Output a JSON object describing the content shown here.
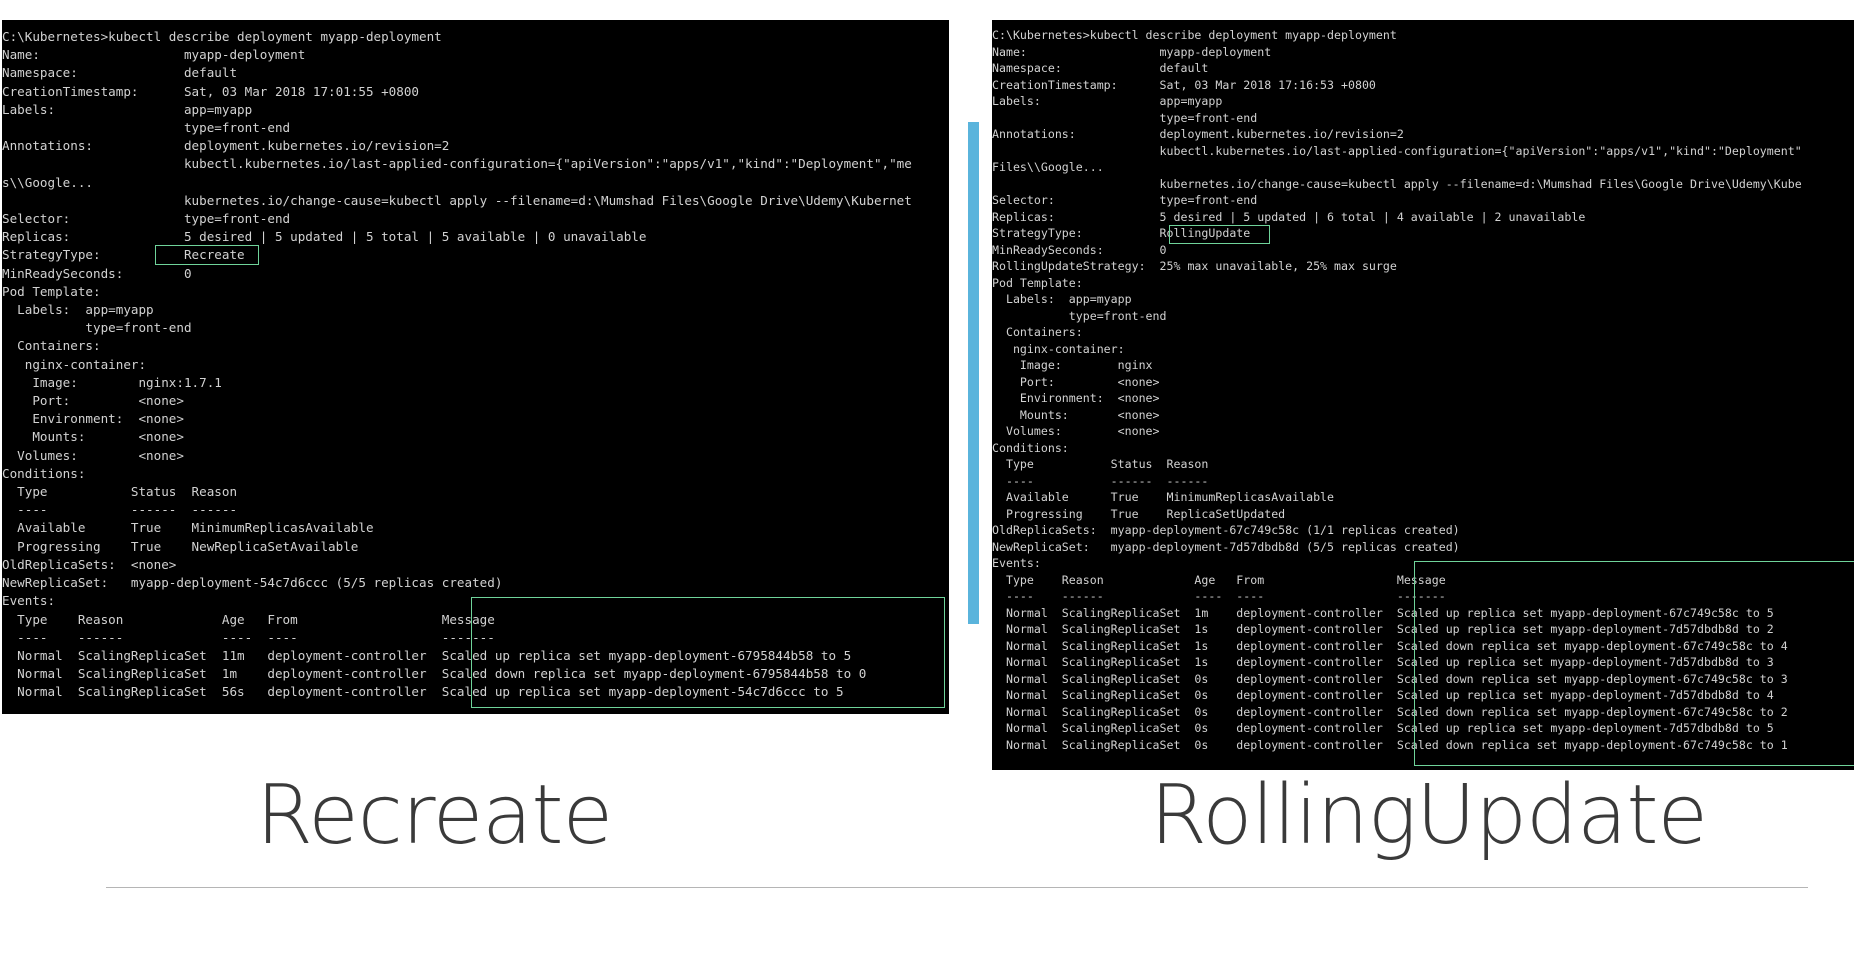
{
  "colors": {
    "terminal_bg": "#000000",
    "terminal_text": "#d2d2d2",
    "highlight_box": "#6fd39a",
    "accent_bar": "#5ab4dc",
    "caption_text": "#3a3a3a",
    "divider": "#b5b5b5"
  },
  "left_terminal": {
    "lines": [
      "C:\\Kubernetes>kubectl describe deployment myapp-deployment",
      "Name:                   myapp-deployment",
      "Namespace:              default",
      "CreationTimestamp:      Sat, 03 Mar 2018 17:01:55 +0800",
      "Labels:                 app=myapp",
      "                        type=front-end",
      "Annotations:            deployment.kubernetes.io/revision=2",
      "                        kubectl.kubernetes.io/last-applied-configuration={\"apiVersion\":\"apps/v1\",\"kind\":\"Deployment\",\"me",
      "s\\\\Google...",
      "                        kubernetes.io/change-cause=kubectl apply --filename=d:\\Mumshad Files\\Google Drive\\Udemy\\Kubernet",
      "Selector:               type=front-end",
      "Replicas:               5 desired | 5 updated | 5 total | 5 available | 0 unavailable",
      "StrategyType:           Recreate",
      "MinReadySeconds:        0",
      "Pod Template:",
      "  Labels:  app=myapp",
      "           type=front-end",
      "  Containers:",
      "   nginx-container:",
      "    Image:        nginx:1.7.1",
      "    Port:         <none>",
      "    Environment:  <none>",
      "    Mounts:       <none>",
      "  Volumes:        <none>",
      "Conditions:",
      "  Type           Status  Reason",
      "  ----           ------  ------",
      "  Available      True    MinimumReplicasAvailable",
      "  Progressing    True    NewReplicaSetAvailable",
      "OldReplicaSets:  <none>",
      "NewReplicaSet:   myapp-deployment-54c7d6ccc (5/5 replicas created)",
      "Events:",
      "  Type    Reason             Age   From                   Message",
      "  ----    ------             ----  ----                   -------",
      "  Normal  ScalingReplicaSet  11m   deployment-controller  Scaled up replica set myapp-deployment-6795844b58 to 5",
      "  Normal  ScalingReplicaSet  1m    deployment-controller  Scaled down replica set myapp-deployment-6795844b58 to 0",
      "  Normal  ScalingReplicaSet  56s   deployment-controller  Scaled up replica set myapp-deployment-54c7d6ccc to 5"
    ]
  },
  "right_terminal": {
    "lines": [
      "C:\\Kubernetes>kubectl describe deployment myapp-deployment",
      "Name:                   myapp-deployment",
      "Namespace:              default",
      "CreationTimestamp:      Sat, 03 Mar 2018 17:16:53 +0800",
      "Labels:                 app=myapp",
      "                        type=front-end",
      "Annotations:            deployment.kubernetes.io/revision=2",
      "                        kubectl.kubernetes.io/last-applied-configuration={\"apiVersion\":\"apps/v1\",\"kind\":\"Deployment\"",
      "Files\\\\Google...",
      "                        kubernetes.io/change-cause=kubectl apply --filename=d:\\Mumshad Files\\Google Drive\\Udemy\\Kube",
      "Selector:               type=front-end",
      "Replicas:               5 desired | 5 updated | 6 total | 4 available | 2 unavailable",
      "StrategyType:           RollingUpdate",
      "MinReadySeconds:        0",
      "RollingUpdateStrategy:  25% max unavailable, 25% max surge",
      "Pod Template:",
      "  Labels:  app=myapp",
      "           type=front-end",
      "  Containers:",
      "   nginx-container:",
      "    Image:        nginx",
      "    Port:         <none>",
      "    Environment:  <none>",
      "    Mounts:       <none>",
      "  Volumes:        <none>",
      "Conditions:",
      "  Type           Status  Reason",
      "  ----           ------  ------",
      "  Available      True    MinimumReplicasAvailable",
      "  Progressing    True    ReplicaSetUpdated",
      "OldReplicaSets:  myapp-deployment-67c749c58c (1/1 replicas created)",
      "NewReplicaSet:   myapp-deployment-7d57dbdb8d (5/5 replicas created)",
      "Events:",
      "  Type    Reason             Age   From                   Message",
      "  ----    ------             ----  ----                   -------",
      "  Normal  ScalingReplicaSet  1m    deployment-controller  Scaled up replica set myapp-deployment-67c749c58c to 5",
      "  Normal  ScalingReplicaSet  1s    deployment-controller  Scaled up replica set myapp-deployment-7d57dbdb8d to 2",
      "  Normal  ScalingReplicaSet  1s    deployment-controller  Scaled down replica set myapp-deployment-67c749c58c to 4",
      "  Normal  ScalingReplicaSet  1s    deployment-controller  Scaled up replica set myapp-deployment-7d57dbdb8d to 3",
      "  Normal  ScalingReplicaSet  0s    deployment-controller  Scaled down replica set myapp-deployment-67c749c58c to 3",
      "  Normal  ScalingReplicaSet  0s    deployment-controller  Scaled up replica set myapp-deployment-7d57dbdb8d to 4",
      "  Normal  ScalingReplicaSet  0s    deployment-controller  Scaled down replica set myapp-deployment-67c749c58c to 2",
      "  Normal  ScalingReplicaSet  0s    deployment-controller  Scaled up replica set myapp-deployment-7d57dbdb8d to 5",
      "  Normal  ScalingReplicaSet  0s    deployment-controller  Scaled down replica set myapp-deployment-67c749c58c to 1"
    ]
  },
  "captions": {
    "left": "Recreate",
    "right": "RollingUpdate"
  }
}
